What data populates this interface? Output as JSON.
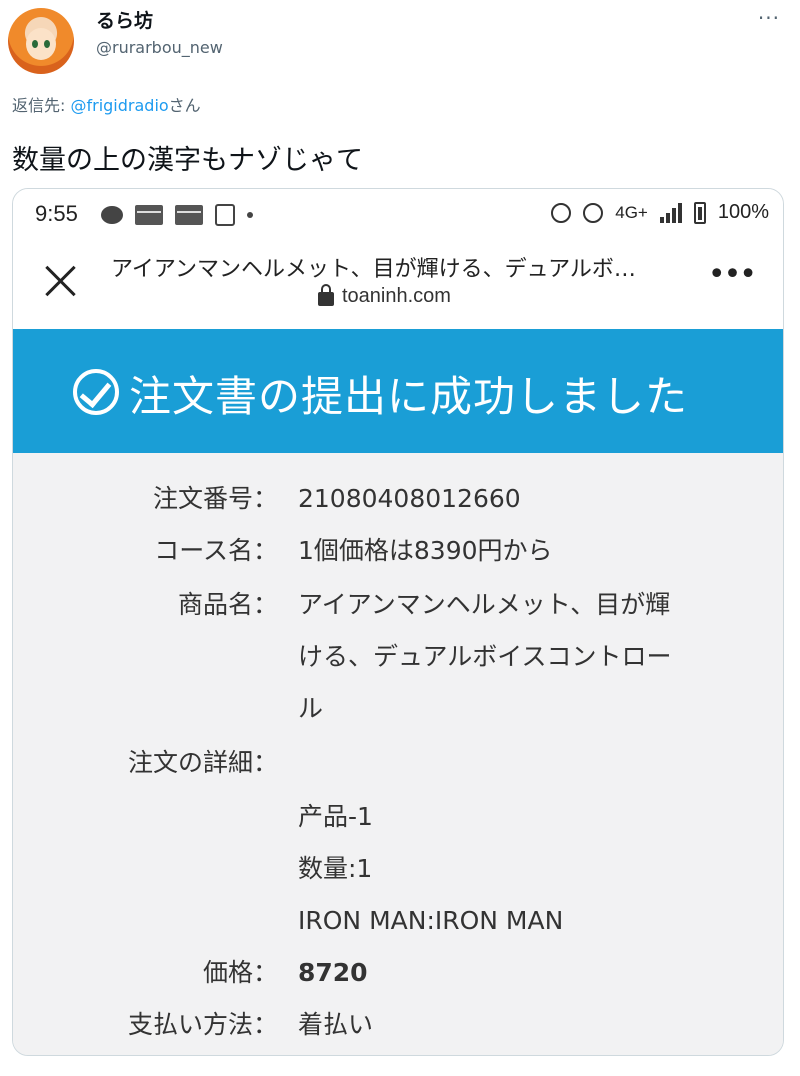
{
  "tweet": {
    "display_name": "るら坊",
    "handle": "@rurarbou_new",
    "more_label": "···",
    "reply_prefix": "返信先: ",
    "reply_mention": "@frigidradio",
    "reply_suffix": "さん",
    "text": "数量の上の漢字もナゾじゃて"
  },
  "screenshot": {
    "status_bar": {
      "time": "9:55",
      "network": "4G+",
      "battery": "100%",
      "icons": [
        "chat-icon",
        "mail-icon",
        "mail-icon",
        "copy-icon",
        "dot-icon",
        "alarm-icon",
        "dnd-icon",
        "signal-icon",
        "battery-icon"
      ]
    },
    "browser": {
      "title": "アイアンマンヘルメット、目が輝ける、デュアルボ…",
      "url": "toaninh.com",
      "menu_label": "•••"
    },
    "banner": {
      "text": "注文書の提出に成功しました",
      "color": "#1a9ed6"
    },
    "order": {
      "order_no_label": "注文番号：",
      "order_no": "21080408012660",
      "course_label": "コース名：",
      "course": "1個価格は8390円から",
      "product_label": "商品名：",
      "product_line1": "アイアンマンヘルメット、目が輝",
      "product_line2": "ける、デュアルボイスコントロー",
      "product_line3": "ル",
      "details_label": "注文の詳細：",
      "detail_item": "产品-1",
      "detail_qty": "数量:1",
      "detail_variant": "IRON MAN:IRON MAN",
      "price_label": "価格：",
      "price": "8720",
      "payment_label": "支払い方法：",
      "payment": "着払い"
    }
  }
}
